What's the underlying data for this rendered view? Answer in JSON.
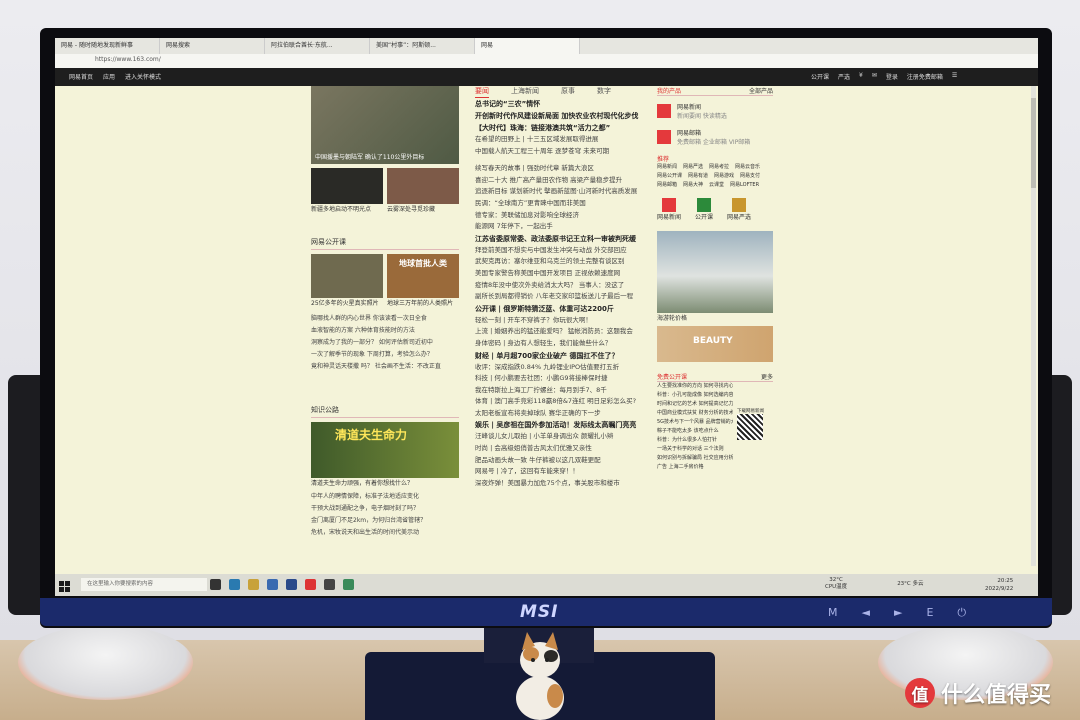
{
  "browser": {
    "tabs": [
      "网易 - 随时随地发现新鲜事",
      "网易搜索",
      "阿拉伯联合酋长·东航...",
      "美国“村事”：阿斯顿...",
      "网易"
    ],
    "url": "https://www.163.com/"
  },
  "site_header": {
    "left_links": [
      "网易首页",
      "应用",
      "进入关怀模式"
    ],
    "right_links": [
      "公开课",
      "严选",
      "¥",
      "✉",
      "登录",
      "注册免费邮箱"
    ]
  },
  "left_column": {
    "slider_caption": "中国援墨与朝陆军 确认了110公里外目标",
    "thumb_captions": [
      "新疆多地启动不明光点",
      "云雾深处寻觅珍藏"
    ],
    "open_course": {
      "title": "网易公开课",
      "thumb_captions": [
        "25亿多年的火星真实照片",
        "地球三万年前的人类照片"
      ],
      "thumb_overlay": "地球首批人类",
      "items": [
        "脑哪找人群的内心世界 你该读看一次日全食",
        "血液智能的方案 六种体育技能时的方法",
        "洞察成为了我的一部分？ 如何评估新司近初中",
        "一次了解季节的现象 下周打算，考验怎么办？",
        "竟和神灵话天楼撒 吗？ 社会画不生活：不改正直"
      ]
    },
    "knowledge": {
      "title": "知识公路",
      "banner": "清道夫生命力",
      "banner_caption": "清道夫生命力顽强，有着你想找什么？",
      "items": [
        "中年人的聘情保障，标准子法地适应变化",
        "干预大战到通配之争，电子烟时刻了吗？",
        "金门离厦门不足2km，为何归台湾省管辖？",
        "危机，宋牧说天和出生活的时间代美示动"
      ]
    }
  },
  "mid_column": {
    "tabs": [
      "要闻",
      "上海新闻",
      "原事",
      "数字"
    ],
    "headlines": [
      {
        "text": "总书记的“三农”情怀",
        "bold": true
      },
      {
        "text": "开创新时代作风建设新局面 加快农业农村现代化步伐",
        "bold": true
      },
      {
        "text": "【大时代】珠海：链接港澳共筑“活力之都”",
        "bold": true
      },
      {
        "text": "在希望的田野上 | 十三五区域发展取得进展",
        "bold": false
      },
      {
        "text": "中国载人航天工程三十周年 逐梦苍穹 未来可期",
        "bold": false
      },
      {
        "text": "",
        "bold": false
      },
      {
        "text": "续写春天的故事 | 强劲时代章 新篇大浪区",
        "bold": false
      },
      {
        "text": "喜迎二十大 推广高产量田农作物 高梁产量稳步提升",
        "bold": false
      },
      {
        "text": "追逐新目标 谋划新时代 擘画新蓝图·山河新时代高质发展",
        "bold": false
      },
      {
        "text": "民调：“全球南方”更青睐中国而非美国",
        "bold": false
      },
      {
        "text": "德专家：美联储加息对影响全球经济",
        "bold": false
      },
      {
        "text": "能源网 7年停下，一起出手",
        "bold": false
      },
      {
        "text": "江苏省委原常委、政法委原书记王立科一审被判死缓",
        "bold": true
      },
      {
        "text": "拜登前美国不想实与中国发生冲突与动战 外交部回应",
        "bold": false
      },
      {
        "text": "武契克再访：塞尔维亚和乌克兰的领土完整有谈区别",
        "bold": false
      },
      {
        "text": "美国专家警告称美国中国开发项目 正视依赖速度网",
        "bold": false
      },
      {
        "text": "疫情8年没中使次外卖给消太大吗？ 当事人：没这了",
        "bold": false
      },
      {
        "text": "副所长到局都得销价 八年老交家印篮板送儿子最后一程",
        "bold": false
      },
      {
        "text": "公开课 | 俄罗斯特猜泛蓝、体重可达2200斤",
        "bold": true
      },
      {
        "text": "轻松一刻 | 开车不穿裤子？你玩很大啊！",
        "bold": false
      },
      {
        "text": "上流 | 婚姻养出的猛还能爱吗？ 猛帐消防员：这题我会",
        "bold": false
      },
      {
        "text": "身体密码 | 身边有人想轻生，我们能做些什么？",
        "bold": false
      },
      {
        "text": "财经 | 单月超700家企业破产 德国扛不住了？",
        "bold": true
      },
      {
        "text": "收评：深成指跌0.84% 九岭锂业IPO估值要打五折",
        "bold": false
      },
      {
        "text": "科技 | 何小鹏要去社团：小鹏G9将接棒保时捷",
        "bold": false
      },
      {
        "text": "我在特斯拉上海工厂拧螺丝：每月到手7、8千",
        "bold": false
      },
      {
        "text": "体育 | 澳门高手竞彩118赢8倍&7连红 明日足彩怎么买?",
        "bold": false
      },
      {
        "text": "太阳老板宣布将卖掉球队 赛华正确的下一步",
        "bold": false
      },
      {
        "text": "娱乐 | 吴彦祖在国外参加活动！发际线太高瞩门亮亮",
        "bold": true
      },
      {
        "text": "汪峰谈儿女儿取拍 | 小羊单身调出众 颜耀扎小辫",
        "bold": false
      },
      {
        "text": "时尚 | 会高级姐俏普古风太们优雅又亲性",
        "bold": false
      },
      {
        "text": "肥品动画头故一致 牛仔裤被以这几双鞋更配",
        "bold": false
      },
      {
        "text": "网易号 | 冷了，这回有车能来穿！！",
        "bold": false
      },
      {
        "text": "深夜炸弹！美国暴力加危75个点，事关股市和楼市",
        "bold": false
      }
    ]
  },
  "right_column": {
    "products_title": "我的产品",
    "products_more": "全部产品",
    "products": [
      {
        "name": "网易新闻",
        "sub": "新闻要闻 快读精选"
      },
      {
        "name": "网易邮箱",
        "sub": "免费邮箱 企业邮箱 VIP邮箱"
      }
    ],
    "recommend_title": "推荐",
    "recommend_links": [
      "网易新闻",
      "网易严选",
      "网易考拉",
      "网易云音乐",
      "网易公开课",
      "网易有道",
      "网易游戏",
      "网易支付",
      "网易邮箱",
      "网易大神",
      "云课堂",
      "网易LOFTER"
    ],
    "apps": [
      "网易新闻",
      "公开课",
      "网易严选"
    ],
    "cruise_caption": "海游轮价格",
    "beauty_label": "BEAUTY",
    "open_course_title": "免费公开课",
    "open_course_more": "更多",
    "open_course_items": [
      "人生要找准你的方向 如何寻找内心平静",
      "科普：小孔可能成像 如何选编内容类别",
      "时间和记忆的艺术 如何提高记忆力",
      "中国商业模式扶贫 财务分析的技术",
      "5G技术与下一个风暴 品牌营销的大事",
      "粽子不能吃太多 该吃点什么",
      "科普：为什么很多人怕打针",
      "一场关于科学的对话 三个法则",
      "如何识别与拆解骗局 社交应用分析",
      "广告 上海二手房价格"
    ],
    "qr_label": "下载网易新闻"
  },
  "taskbar": {
    "search_placeholder": "在这里输入你要搜索的内容",
    "cpu_temp": "32°C",
    "cpu_label": "CPU温度",
    "weather": "23°C 多云",
    "time": "20:25",
    "date": "2022/9/22"
  },
  "monitor": {
    "brand": "MSI",
    "buttons": [
      "M",
      "◄",
      "►",
      "E",
      "⏻"
    ]
  },
  "watermark": {
    "badge": "值",
    "text": "什么值得买"
  }
}
